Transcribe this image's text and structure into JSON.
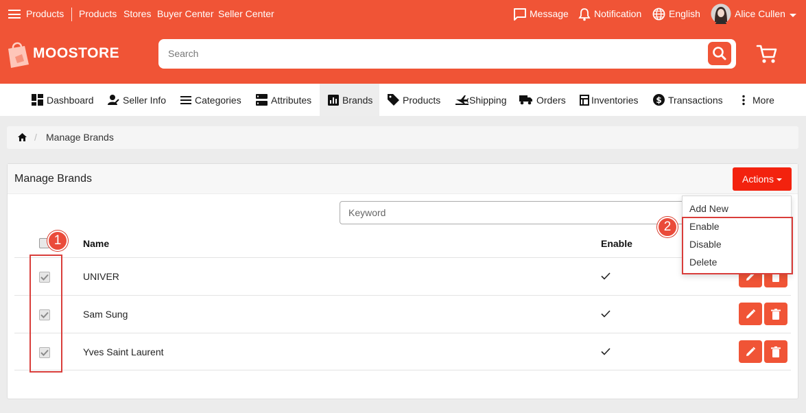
{
  "topnav": {
    "products": "Products",
    "products2": "Products",
    "stores": "Stores",
    "buyer_center": "Buyer Center",
    "seller_center": "Seller Center",
    "message": "Message",
    "notification": "Notification",
    "language": "English",
    "user_name": "Alice Cullen"
  },
  "brand": {
    "logo_text": "MOOSTORE"
  },
  "search": {
    "placeholder": "Search"
  },
  "menu": {
    "items": [
      {
        "label": "Dashboard",
        "icon": "dashboard-icon"
      },
      {
        "label": "Seller Info",
        "icon": "seller-info-icon"
      },
      {
        "label": "Categories",
        "icon": "list-icon"
      },
      {
        "label": "Attributes",
        "icon": "server-icon"
      },
      {
        "label": "Brands",
        "icon": "chart-icon",
        "active": true
      },
      {
        "label": "Products",
        "icon": "tag-icon"
      },
      {
        "label": "Shipping",
        "icon": "airplane-icon"
      },
      {
        "label": "Orders",
        "icon": "truck-icon"
      },
      {
        "label": "Inventories",
        "icon": "inventory-icon"
      },
      {
        "label": "Transactions",
        "icon": "dollar-icon"
      },
      {
        "label": "More",
        "icon": "more-vertical-icon"
      }
    ]
  },
  "breadcrumb": {
    "current": "Manage Brands",
    "separator": "/"
  },
  "card": {
    "title": "Manage Brands",
    "actions_label": "Actions",
    "keyword_placeholder": "Keyword"
  },
  "table": {
    "columns": {
      "name": "Name",
      "enable": "Enable"
    },
    "rows": [
      {
        "name": "UNIVER",
        "enabled": true,
        "checked": true
      },
      {
        "name": "Sam Sung",
        "enabled": true,
        "checked": true
      },
      {
        "name": "Yves Saint Laurent",
        "enabled": true,
        "checked": true
      }
    ]
  },
  "actions_menu": {
    "items": [
      "Add New",
      "Enable",
      "Disable",
      "Delete"
    ]
  },
  "annotations": {
    "step1": "1",
    "step2": "2"
  },
  "colors": {
    "brand": "#f05436",
    "action_button": "#f3220e",
    "highlight": "#d93d3a"
  }
}
